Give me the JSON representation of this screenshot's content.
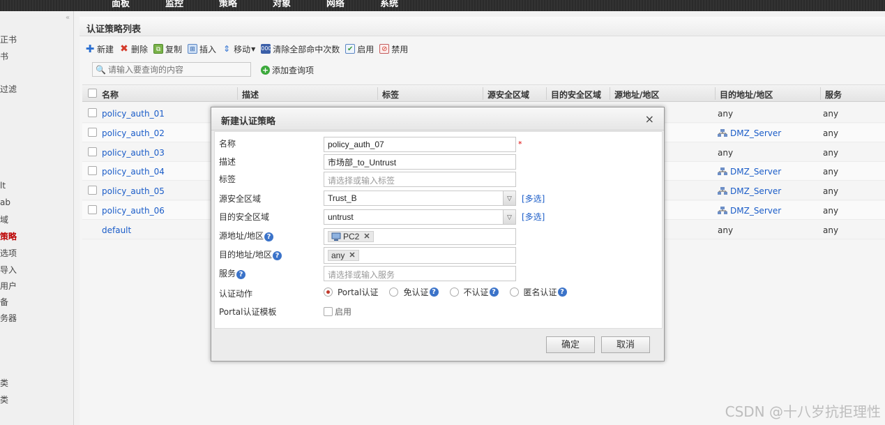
{
  "topnav": {
    "items": [
      "面板",
      "监控",
      "策略",
      "对象",
      "网络",
      "系统"
    ]
  },
  "sidebar": {
    "items": [
      "正书",
      "书",
      "过滤",
      "lt",
      "ab",
      "域",
      "策略",
      "选项",
      "导入",
      "用户",
      "备",
      "务器",
      "类",
      "类"
    ],
    "active_index": 6
  },
  "panel": {
    "title": "认证策略列表"
  },
  "toolbar": {
    "new": "新建",
    "delete": "删除",
    "copy": "复制",
    "insert": "插入",
    "move": "移动",
    "clear_hits": "清除全部命中次数",
    "enable": "启用",
    "disable": "禁用"
  },
  "search": {
    "placeholder": "请输入要查询的内容",
    "add_query": "添加查询项"
  },
  "table": {
    "headers": [
      "名称",
      "描述",
      "标签",
      "源安全区域",
      "目的安全区域",
      "源地址/地区",
      "目的地址/地区",
      "服务"
    ],
    "rows": [
      {
        "name": "policy_auth_01",
        "dest": "any",
        "service": "any",
        "dest_is_link": false
      },
      {
        "name": "policy_auth_02",
        "dest": "DMZ_Server",
        "service": "any",
        "dest_is_link": true
      },
      {
        "name": "policy_auth_03",
        "dest": "any",
        "service": "any",
        "dest_is_link": false
      },
      {
        "name": "policy_auth_04",
        "dest": "DMZ_Server",
        "service": "any",
        "dest_is_link": true
      },
      {
        "name": "policy_auth_05",
        "dest": "DMZ_Server",
        "service": "any",
        "dest_is_link": true
      },
      {
        "name": "policy_auth_06",
        "dest": "DMZ_Server",
        "service": "any",
        "dest_is_link": true
      },
      {
        "name": "default",
        "dest": "any",
        "service": "any",
        "dest_is_link": false
      }
    ]
  },
  "dialog": {
    "title": "新建认证策略",
    "close": "×",
    "fields": {
      "name_label": "名称",
      "name_value": "policy_auth_07",
      "required_mark": "*",
      "desc_label": "描述",
      "desc_value": "市场部_to_Untrust",
      "tag_label": "标签",
      "tag_placeholder": "请选择或输入标签",
      "src_zone_label": "源安全区域",
      "src_zone_value": "Trust_B",
      "dst_zone_label": "目的安全区域",
      "dst_zone_value": "untrust",
      "multi_select": "[多选]",
      "src_addr_label": "源地址/地区",
      "src_addr_tag": "PC2",
      "dst_addr_label": "目的地址/地区",
      "dst_addr_tag": "any",
      "service_label": "服务",
      "service_placeholder": "请选择或输入服务",
      "action_label": "认证动作",
      "action_options": [
        "Portal认证",
        "免认证",
        "不认证",
        "匿名认证"
      ],
      "action_selected": 0,
      "portal_template_label": "Portal认证模板",
      "enable_label": "启用"
    },
    "ok": "确定",
    "cancel": "取消"
  },
  "watermark": "CSDN @十八岁抗拒理性"
}
